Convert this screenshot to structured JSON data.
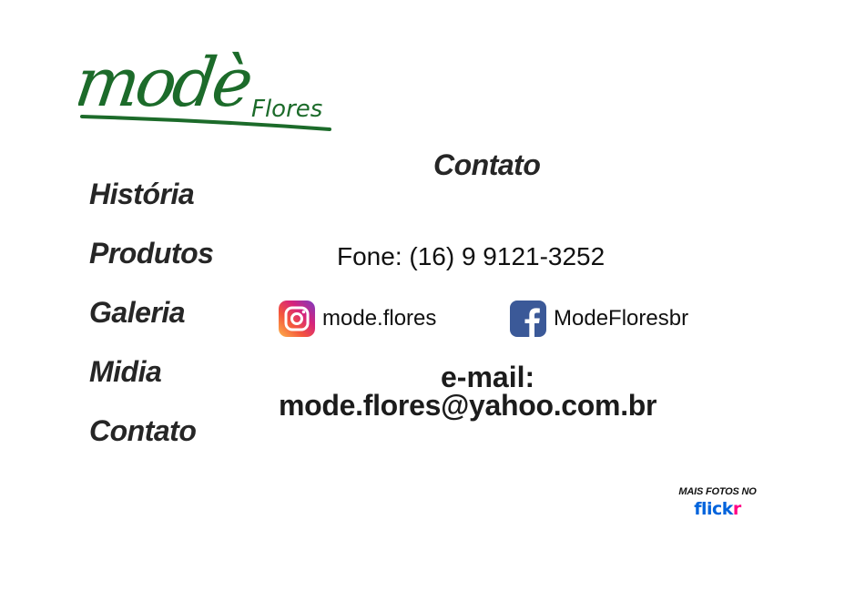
{
  "logo": {
    "primary": "modè",
    "secondary": "Flores",
    "color": "#1c6b2a"
  },
  "nav": {
    "items": [
      {
        "label": "História"
      },
      {
        "label": "Produtos"
      },
      {
        "label": "Galeria"
      },
      {
        "label": "Midia"
      },
      {
        "label": "Contato"
      }
    ]
  },
  "contact": {
    "title": "Contato",
    "phone": "Fone: (16) 9 9121-3252",
    "instagram": {
      "handle": "mode.flores",
      "icon": "instagram-icon"
    },
    "facebook": {
      "handle": "ModeFloresbr",
      "icon": "facebook-icon",
      "color": "#3b5998"
    },
    "email_label": "e-mail:",
    "email": "mode.flores@yahoo.com.br"
  },
  "flickr": {
    "caption": "MAIS FOTOS NO",
    "brand_part1": "flick",
    "brand_part2": "r",
    "colors": {
      "blue": "#0063dc",
      "pink": "#ff0084"
    }
  }
}
